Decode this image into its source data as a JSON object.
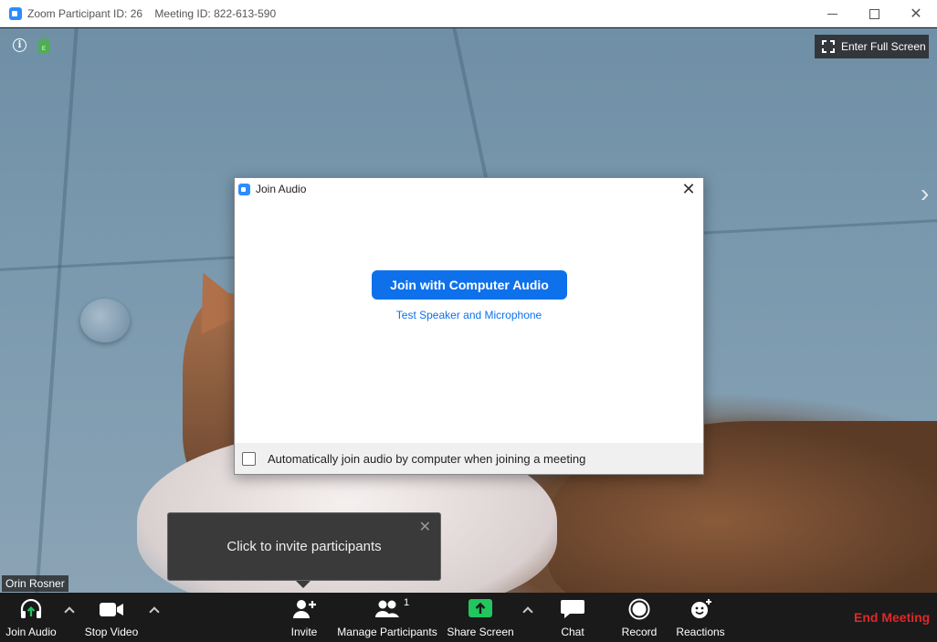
{
  "window": {
    "participant_id": "Zoom Participant ID: 26",
    "meeting_id": "Meeting ID: 822-613-590"
  },
  "video": {
    "fullscreen_label": "Enter Full Screen",
    "participant_name": "Orin Rosner"
  },
  "dialog": {
    "title": "Join Audio",
    "join_button": "Join with Computer Audio",
    "test_link": "Test Speaker and Microphone",
    "auto_join_label": "Automatically join audio by computer when joining a meeting",
    "auto_join_checked": false
  },
  "tooltip": {
    "text": "Click to invite participants"
  },
  "toolbar": {
    "join_audio": "Join Audio",
    "stop_video": "Stop Video",
    "invite": "Invite",
    "manage_participants": "Manage Participants",
    "participant_count": "1",
    "share_screen": "Share Screen",
    "chat": "Chat",
    "record": "Record",
    "reactions": "Reactions",
    "end_meeting": "End Meeting"
  },
  "colors": {
    "accent": "#0e71eb",
    "share_green": "#22c55e",
    "end_red": "#e02828",
    "toolbar_bg": "#1a1a1a"
  }
}
